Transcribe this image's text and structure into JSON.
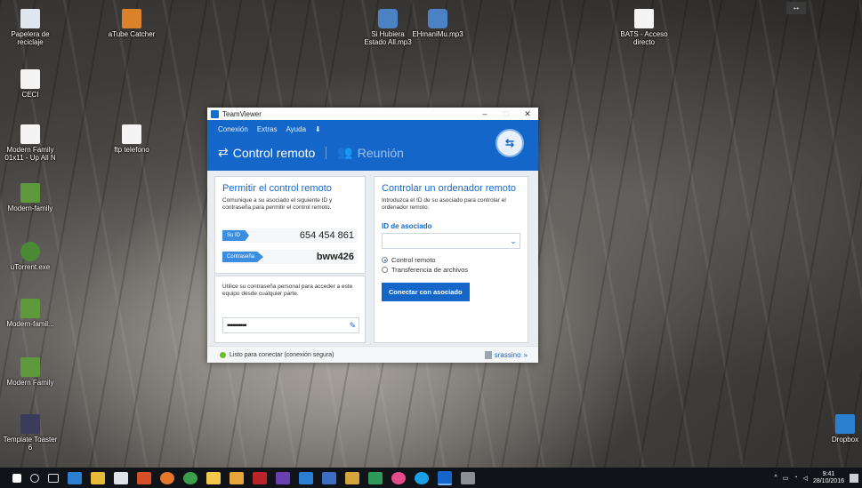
{
  "desktop": {
    "icons": [
      {
        "label": "Papelera de reciclaje",
        "kind": "bin"
      },
      {
        "label": "aTube Catcher",
        "kind": "orange"
      },
      {
        "label": "CECI",
        "kind": "doc"
      },
      {
        "label": "Modern Family 01x11 - Up All N",
        "kind": "doc"
      },
      {
        "label": "ftp telefono",
        "kind": "doc"
      },
      {
        "label": "Modern-family",
        "kind": "green"
      },
      {
        "label": "uTorrent.exe",
        "kind": "utor"
      },
      {
        "label": "Modern-famil...",
        "kind": "green"
      },
      {
        "label": "Modern Family",
        "kind": "green"
      },
      {
        "label": "Template Toaster 6",
        "kind": "tt"
      },
      {
        "label": "Si Hubiera Estado All.mp3",
        "kind": "media"
      },
      {
        "label": "EHmaniMu.mp3",
        "kind": "media"
      },
      {
        "label": "BATS - Acceso directo",
        "kind": "doc"
      },
      {
        "label": "Dropbox",
        "kind": "drop"
      }
    ]
  },
  "teamviewer": {
    "window_title": "TeamViewer",
    "menu": [
      "Conexión",
      "Extras",
      "Ayuda"
    ],
    "tab_remote": "Control remoto",
    "tab_meeting": "Reunión",
    "allow": {
      "title": "Permitir el control remoto",
      "text": "Comunique a su asociado el siguiente ID y contraseña para permitir el control remoto.",
      "id_label": "Su ID",
      "id_value": "654 454 861",
      "pw_label": "Contraseña",
      "pw_value": "bww426"
    },
    "personal": {
      "text": "Utilice su contraseña personal para acceder a este equipo desde cualquier parte.",
      "password_dots": "••••••••••"
    },
    "control": {
      "title": "Controlar un ordenador remoto",
      "text": "Introduzca el ID de su asociado para controlar el ordenador remoto.",
      "partner_label": "ID de asociado",
      "partner_value": "",
      "option_remote": "Control remoto",
      "option_files": "Transferencia de archivos",
      "connect": "Conectar con asociado"
    },
    "status": "Listo para conectar (conexión segura)",
    "user": "srassino"
  },
  "taskbar": {
    "time": "9:41",
    "date": "28/10/2016"
  },
  "colors": {
    "accent": "#1467c8",
    "status_ready": "#6bbf2a"
  }
}
